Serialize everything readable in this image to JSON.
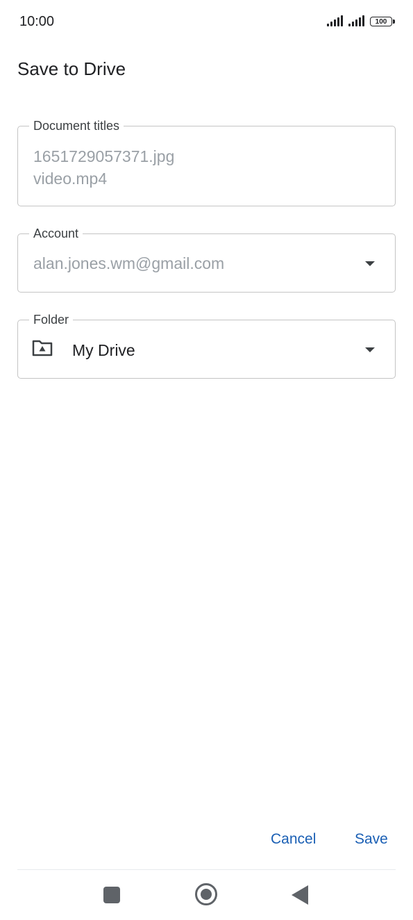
{
  "status_bar": {
    "time": "10:00",
    "battery": "100",
    "icons": [
      "signal-icon",
      "signal-icon",
      "battery-icon"
    ]
  },
  "dialog": {
    "title": "Save to Drive"
  },
  "document_titles": {
    "label": "Document titles",
    "files": [
      "1651729057371.jpg",
      "video.mp4"
    ]
  },
  "account": {
    "label": "Account",
    "value": "alan.jones.wm@gmail.com"
  },
  "folder": {
    "label": "Folder",
    "value": "My Drive",
    "icon": "drive-folder-icon"
  },
  "actions": {
    "cancel_label": "Cancel",
    "save_label": "Save"
  },
  "navigation": {
    "icons": [
      "recents-icon",
      "home-icon",
      "back-icon"
    ]
  },
  "colors": {
    "accent": "#1a5fb4",
    "placeholder_text": "#9aa0a6",
    "outline": "#c4c4c4"
  }
}
